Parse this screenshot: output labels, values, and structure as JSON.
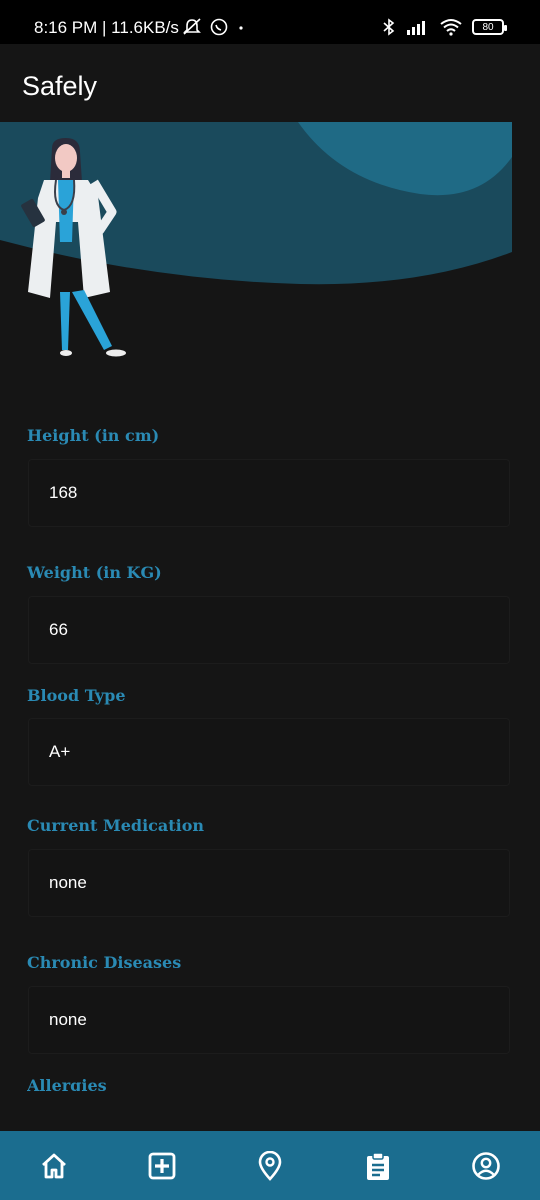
{
  "status_bar": {
    "time_speed": "8:16 PM | 11.6KB/s",
    "battery": "80"
  },
  "app_bar": {
    "title": "Safely"
  },
  "colors": {
    "accent": "#2a8ab4",
    "nav_bg": "#1b6d8f",
    "hero_wave": "#1a4a5c",
    "hero_wave_light": "#1f6a85",
    "background": "#151515"
  },
  "fields": [
    {
      "label": "Height (in cm)",
      "value": "168"
    },
    {
      "label": "Weight (in KG)",
      "value": "66"
    },
    {
      "label": "Blood Type",
      "value": "A+"
    },
    {
      "label": "Current Medication",
      "value": "none"
    },
    {
      "label": "Chronic Diseases",
      "value": "none"
    },
    {
      "label": "Allergies",
      "value": ""
    }
  ],
  "bottom_nav": [
    {
      "icon": "home-icon"
    },
    {
      "icon": "medical-plus-icon"
    },
    {
      "icon": "location-pin-icon"
    },
    {
      "icon": "clipboard-icon"
    },
    {
      "icon": "profile-icon"
    }
  ]
}
